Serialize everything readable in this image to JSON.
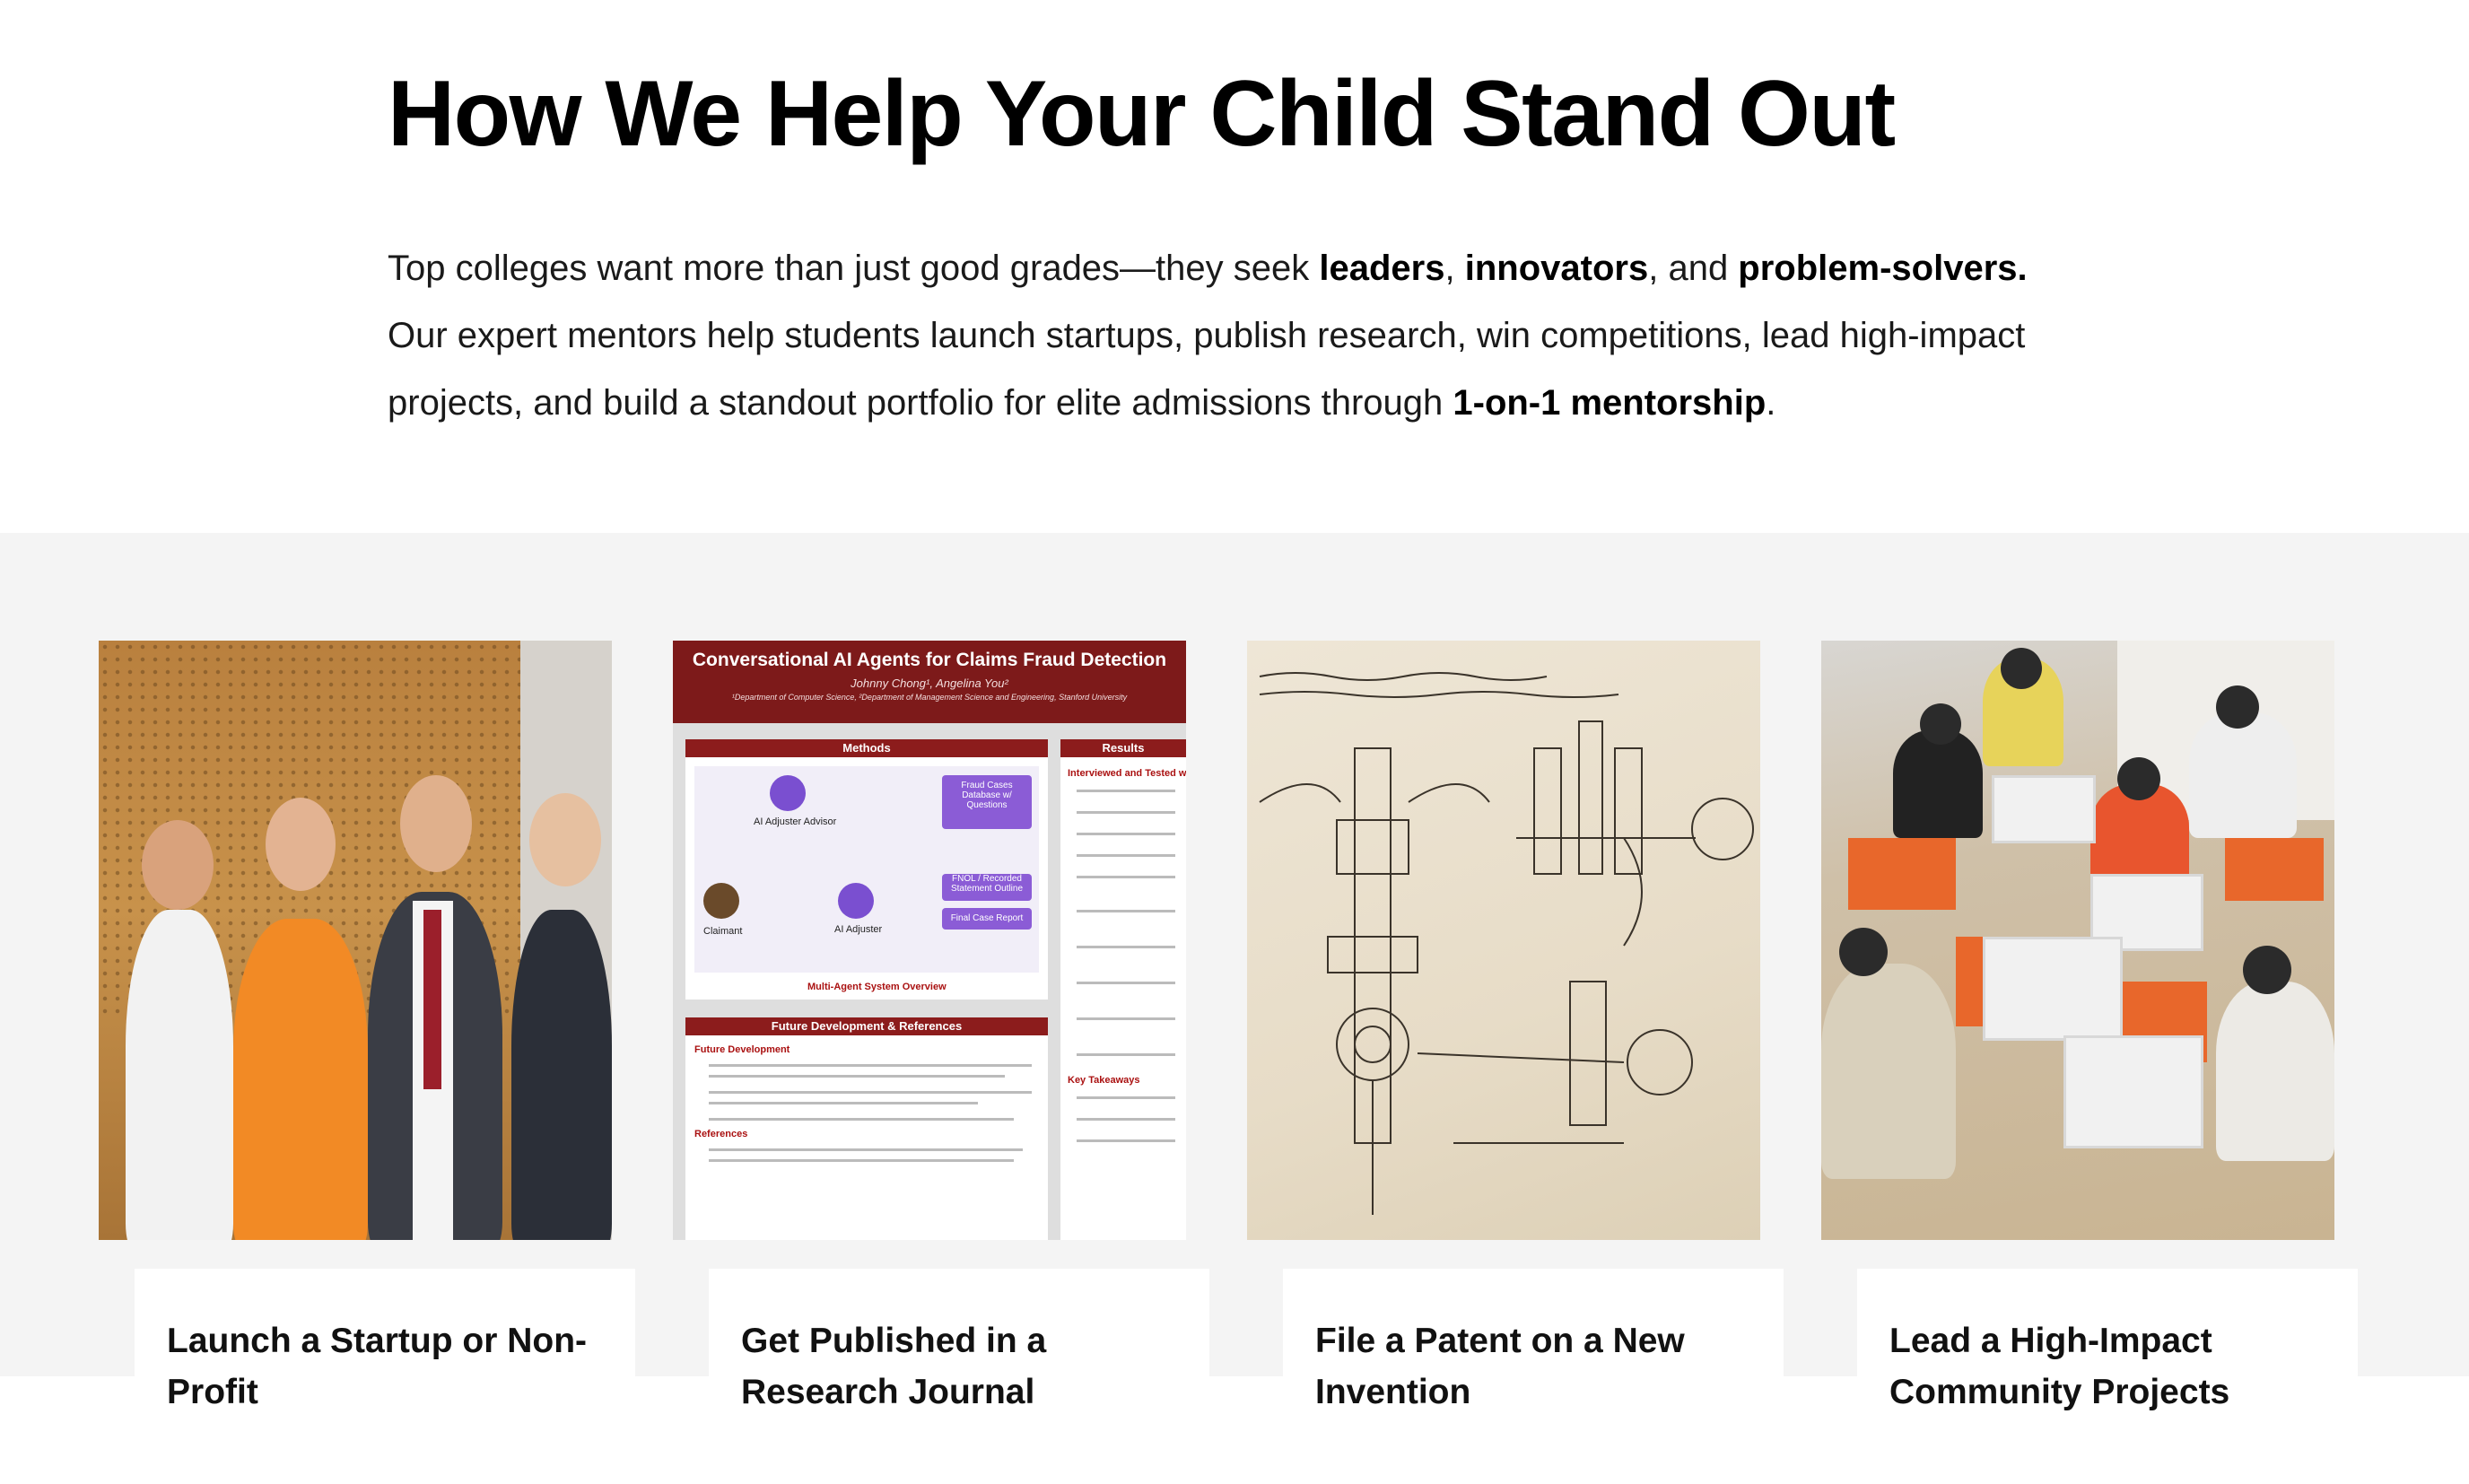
{
  "hero": {
    "title": "How We Help Your Child Stand Out",
    "intro": {
      "p1": "Top colleges want more than just good grades—they seek ",
      "b1": "leaders",
      "p2": ", ",
      "b2": "innovators",
      "p3": ", and ",
      "b3": "problem-solvers.",
      "p4": " Our expert mentors help students launch startups, publish research, win competitions, lead high-impact projects, and build a standout portfolio for elite admissions through ",
      "b4": "1-on-1 mentorship",
      "p5": "."
    }
  },
  "cards": [
    {
      "title": "Launch a Startup or Non-Profit",
      "image": "group-photo"
    },
    {
      "title": "Get Published in a Research Journal",
      "image": "research-poster"
    },
    {
      "title": "File a Patent on a New Invention",
      "image": "patent-sketch"
    },
    {
      "title": "Lead a High-Impact Community Projects",
      "image": "kids-robotics-photo"
    }
  ],
  "poster": {
    "title": "Conversational AI Agents for Claims Fraud Detection",
    "authors": "Johnny Chong¹, Angelina You²",
    "affiliation": "¹Department of Computer Science, ²Department of Management Science and Engineering, Stanford University",
    "methods": "Methods",
    "results": "Results",
    "future": "Future Development & References",
    "advisor": "AI Adjuster Advisor",
    "claimant": "Claimant",
    "adjuster": "AI Adjuster",
    "db": "Fraud Cases Database w/ Questions",
    "fnol": "FNOL / Recorded Statement Outline",
    "report": "Final Case Report",
    "overview": "Multi-Agent System Overview",
    "fd_head": "Future Development",
    "refs": "References",
    "res_head": "Interviewed and Tested w",
    "takeaways": "Key Takeaways"
  },
  "colors": {
    "section_bg": "#f4f4f4",
    "poster_red": "#7d1a1a",
    "poster_purple": "#8b5cd6"
  }
}
